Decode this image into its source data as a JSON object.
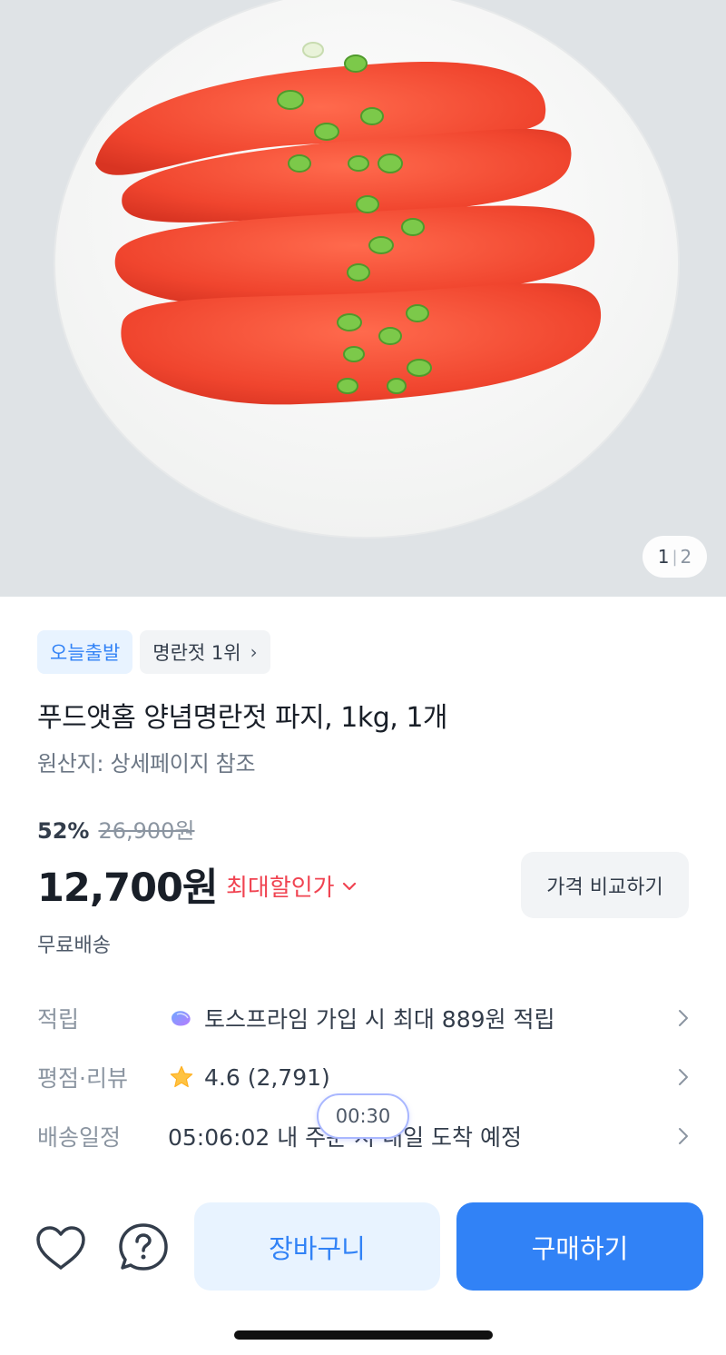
{
  "hero": {
    "image_counter": {
      "current": "1",
      "separator": "|",
      "total": "2"
    }
  },
  "badges": [
    {
      "label": "오늘출발"
    },
    {
      "label": "명란젓 1위",
      "chevron": "›"
    }
  ],
  "product": {
    "title": "푸드앳홈 양념명란젓 파지, 1kg, 1개",
    "origin": "원산지: 상세페이지 참조"
  },
  "pricing": {
    "discount_percent": "52%",
    "original_price": "26,900원",
    "sale_price": "12,700원",
    "max_discount_label": "최대할인가",
    "compare_button": "가격 비교하기",
    "shipping": "무료배송"
  },
  "info_rows": [
    {
      "label": "적립",
      "value": "토스프라임 가입 시 최대 889원 적립",
      "icon": "toss-prime-icon"
    },
    {
      "label": "평점·리뷰",
      "value": "4.6 (2,791)",
      "icon": "star-icon"
    },
    {
      "label": "배송일정",
      "value": "05:06:02 내 주문 시 내일 도착 예정"
    }
  ],
  "timer_bubble": "00:30",
  "bottom_bar": {
    "wishlist_icon": "heart-icon",
    "help_icon": "question-icon",
    "cart_button": "장바구니",
    "buy_button": "구매하기"
  },
  "colors": {
    "accent_blue": "#3182f6",
    "discount_red": "#f04452",
    "star_yellow": "#ffc342"
  }
}
